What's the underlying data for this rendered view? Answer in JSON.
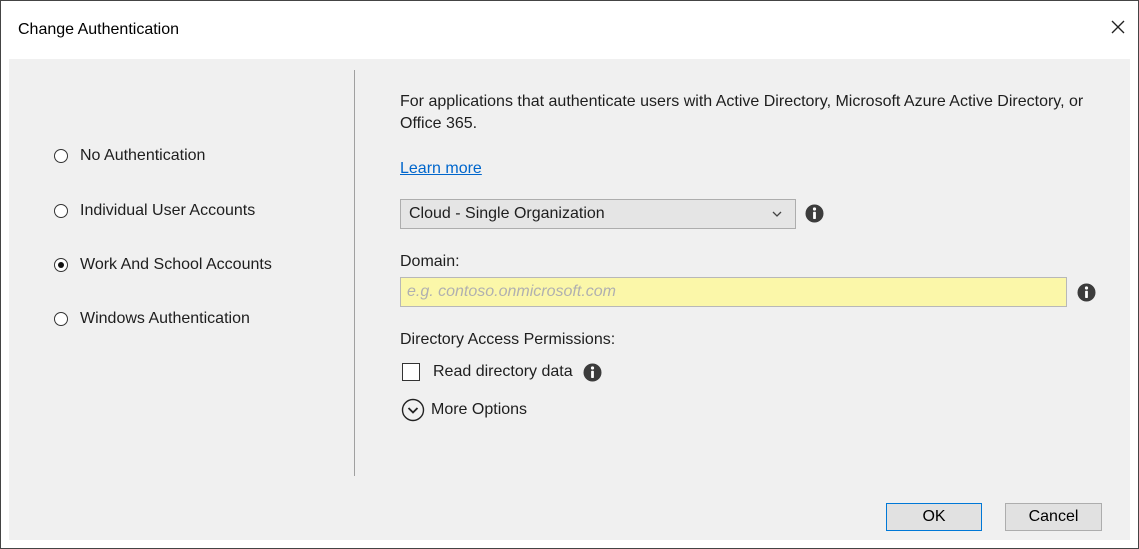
{
  "window": {
    "title": "Change Authentication",
    "close_icon": "close-icon"
  },
  "auth_options": [
    {
      "label": "No Authentication",
      "checked": false
    },
    {
      "label": "Individual User Accounts",
      "checked": false
    },
    {
      "label": "Work And School Accounts",
      "checked": true
    },
    {
      "label": "Windows Authentication",
      "checked": false
    }
  ],
  "details": {
    "description": "For applications that authenticate users with Active Directory, Microsoft Azure Active Directory, or Office 365.",
    "learn_more": "Learn more",
    "org_type": {
      "selected": "Cloud - Single Organization",
      "icon": "chevron-down-icon"
    },
    "domain": {
      "label": "Domain:",
      "value": "",
      "placeholder": "e.g. contoso.onmicrosoft.com"
    },
    "permissions": {
      "label": "Directory Access Permissions:",
      "read_directory_label": "Read directory data",
      "read_directory_checked": false
    },
    "more_options": {
      "label": "More Options",
      "icon": "chevron-down-circle-icon"
    }
  },
  "buttons": {
    "ok": "OK",
    "cancel": "Cancel"
  },
  "colors": {
    "dialog_background": "#f0f0f0",
    "domain_field_background": "#fbf7a9",
    "link": "#0066cc",
    "ok_border": "#0078d7"
  }
}
